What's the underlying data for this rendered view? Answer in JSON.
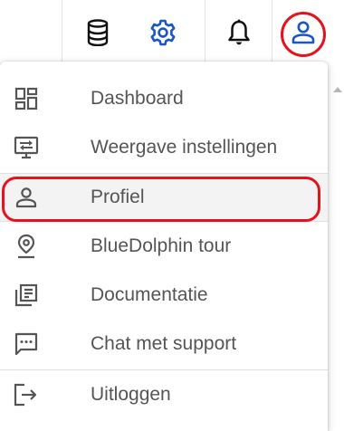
{
  "topbar": {
    "icons": [
      "database-icon",
      "gear-icon",
      "bell-icon",
      "user-icon"
    ],
    "accent_color": "#1a56c4",
    "highlight_color": "#e3141d"
  },
  "menu": {
    "items": [
      {
        "label": "Dashboard",
        "icon": "dashboard-icon"
      },
      {
        "label": "Weergave instellingen",
        "icon": "display-settings-icon"
      },
      {
        "label": "Profiel",
        "icon": "user-icon"
      },
      {
        "label": "BlueDolphin tour",
        "icon": "location-pin-icon"
      },
      {
        "label": "Documentatie",
        "icon": "documentation-icon"
      },
      {
        "label": "Chat met support",
        "icon": "chat-icon"
      },
      {
        "label": "Uitloggen",
        "icon": "logout-icon"
      }
    ]
  }
}
